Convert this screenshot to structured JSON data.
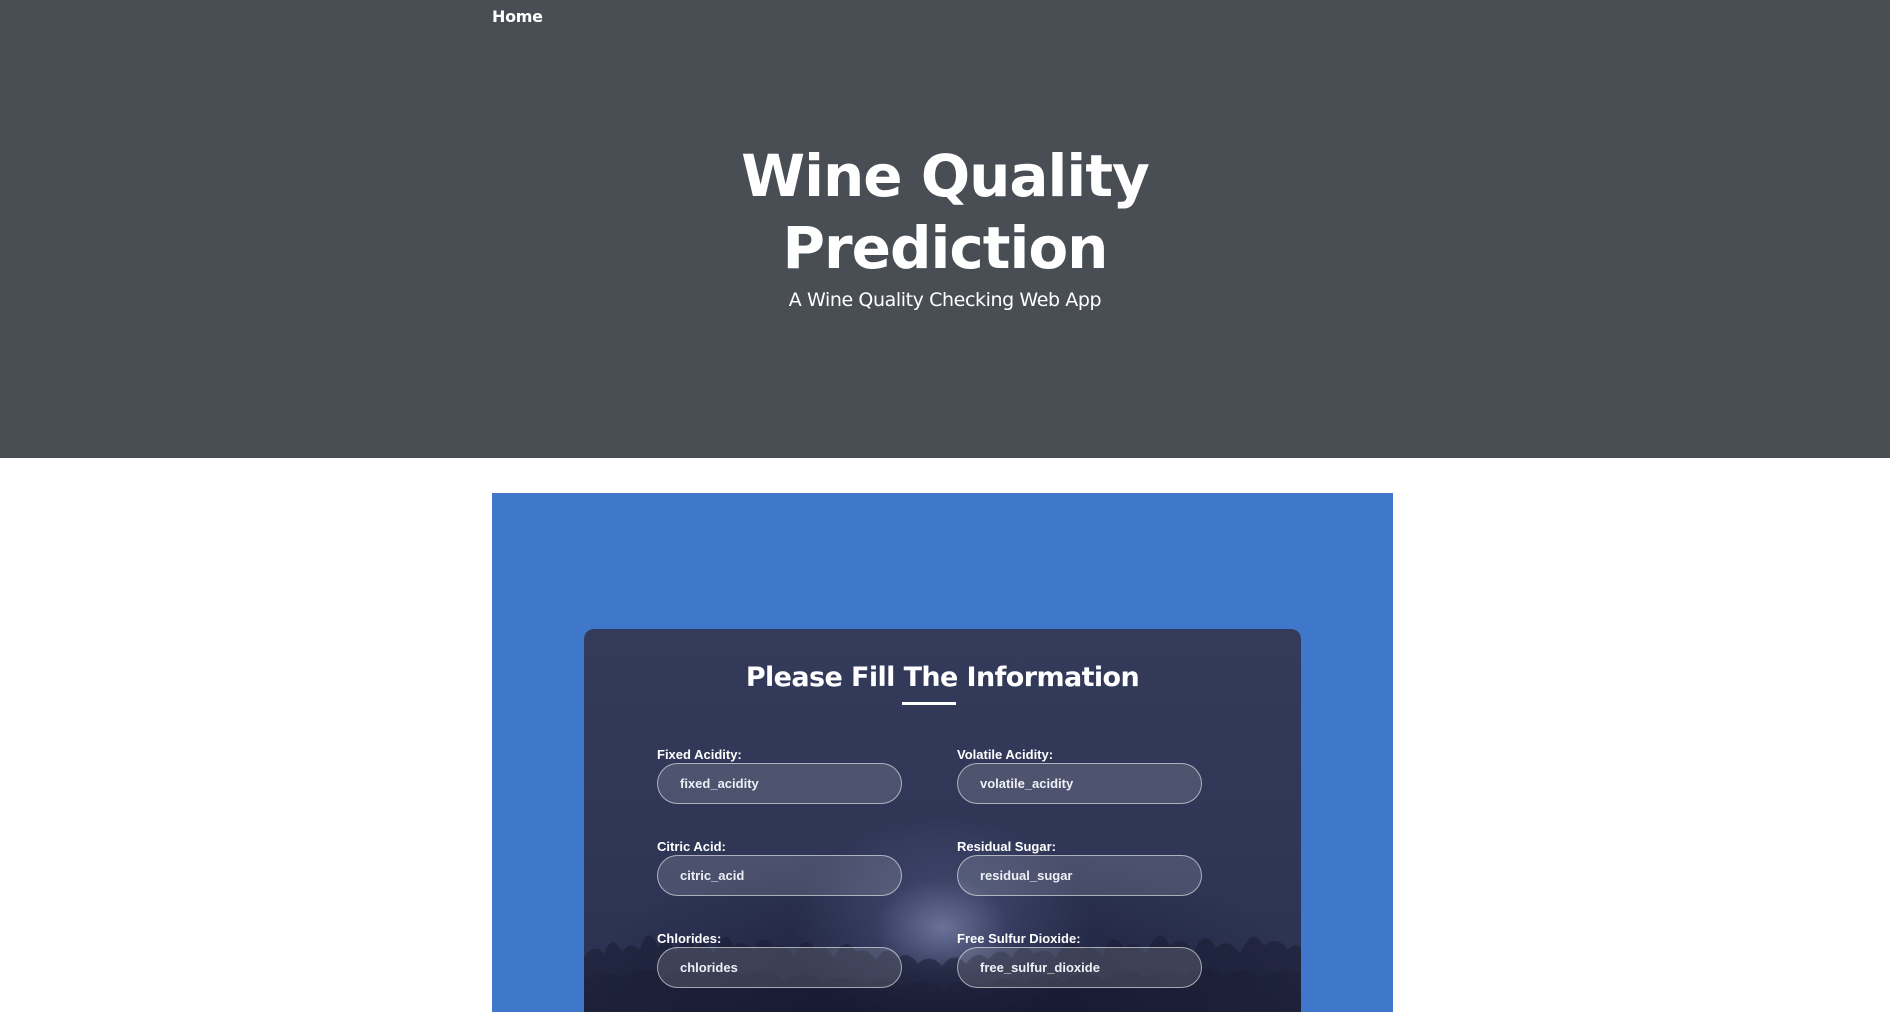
{
  "nav": {
    "home_label": "Home"
  },
  "hero": {
    "title_line1": "Wine Quality",
    "title_line2": "Prediction",
    "subtitle": "A Wine Quality Checking Web App"
  },
  "form": {
    "title": "Please Fill The Information",
    "fields": [
      {
        "label": "Fixed Acidity:",
        "placeholder": "fixed_acidity",
        "value": ""
      },
      {
        "label": "Volatile Acidity:",
        "placeholder": "volatile_acidity",
        "value": ""
      },
      {
        "label": "Citric Acid:",
        "placeholder": "citric_acid",
        "value": ""
      },
      {
        "label": "Residual Sugar:",
        "placeholder": "residual_sugar",
        "value": ""
      },
      {
        "label": "Chlorides:",
        "placeholder": "chlorides",
        "value": ""
      },
      {
        "label": "Free Sulfur Dioxide:",
        "placeholder": "free_sulfur_dioxide",
        "value": ""
      }
    ]
  },
  "colors": {
    "hero_background": "#494d54",
    "panel_background": "#3f78ca",
    "card_background": "#2f3656",
    "text": "#ffffff"
  }
}
